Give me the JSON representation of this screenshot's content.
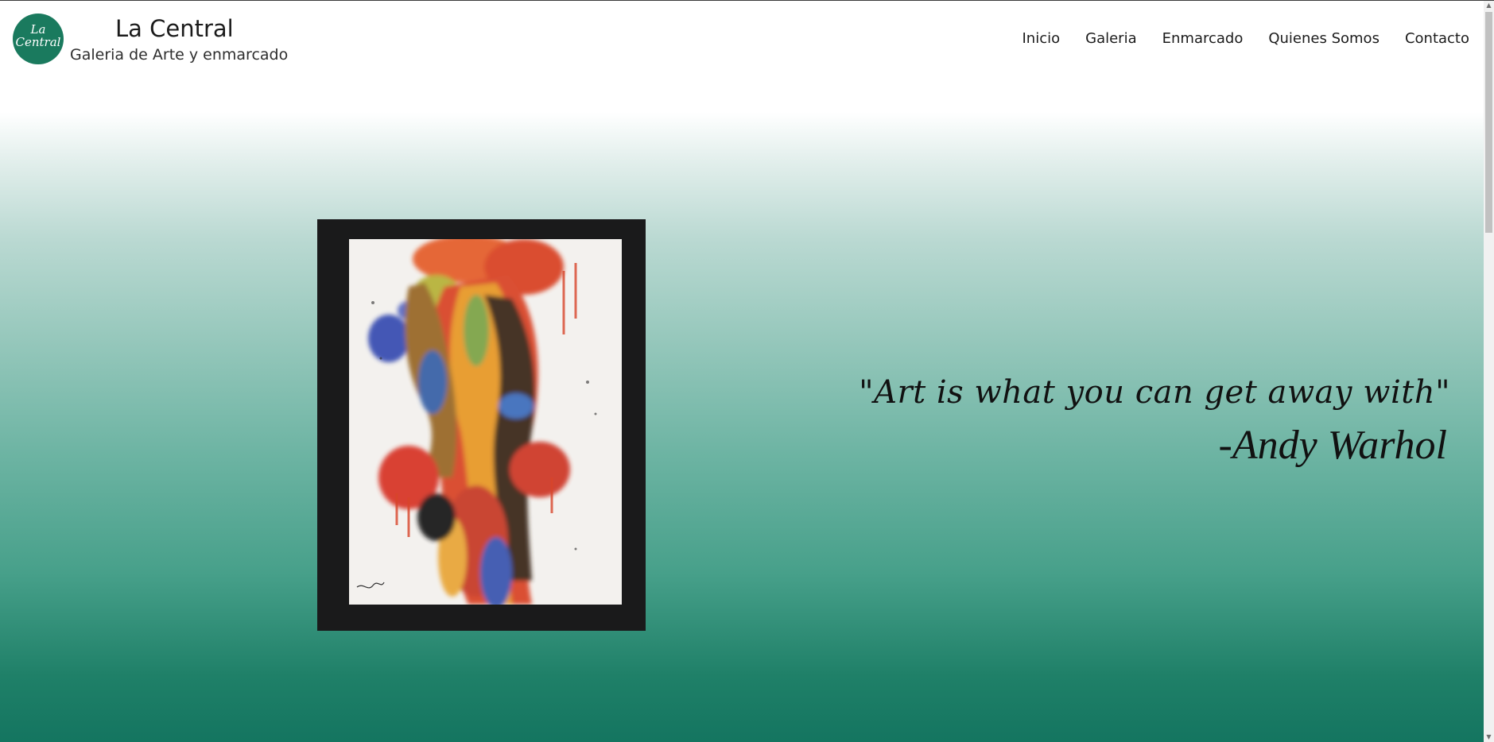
{
  "brand": {
    "logo_line1": "La",
    "logo_line2": "Central",
    "title": "La Central",
    "subtitle": "Galeria de Arte y enmarcado",
    "logo_color": "#1a7a5e"
  },
  "nav": {
    "items": [
      {
        "label": "Inicio"
      },
      {
        "label": "Galeria"
      },
      {
        "label": "Enmarcado"
      },
      {
        "label": "Quienes Somos"
      },
      {
        "label": "Contacto"
      }
    ]
  },
  "hero": {
    "quote": "\"Art is what you can get away with\"",
    "author": "-Andy Warhol",
    "gradient_colors": [
      "#ffffff",
      "#95c7bb",
      "#147560"
    ]
  },
  "painting": {
    "icon": "abstract-painting-image",
    "frame_color": "#1a1a1b"
  },
  "scrollbar": {
    "up_icon": "scroll-up-arrow-icon",
    "down_icon": "scroll-down-arrow-icon"
  }
}
